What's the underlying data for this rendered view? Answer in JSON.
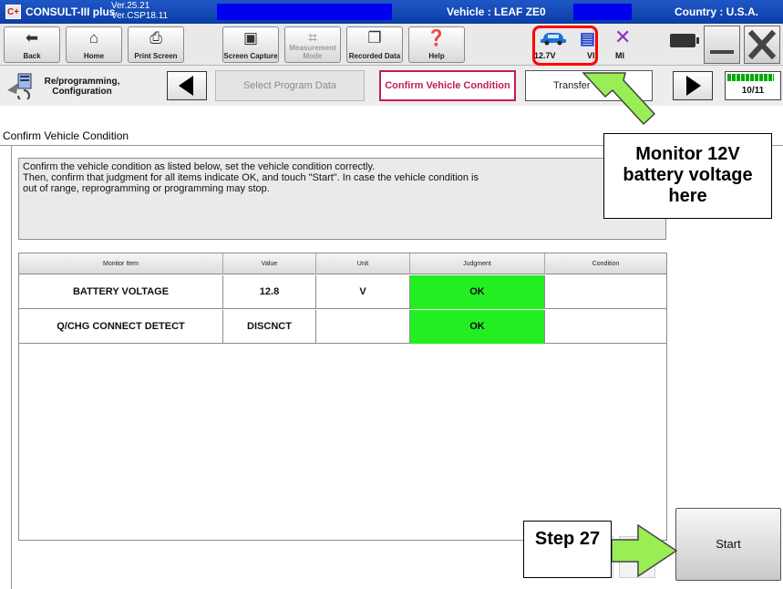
{
  "titlebar": {
    "logo": "C+",
    "app_name": "CONSULT-III plus",
    "version_line1": "Ver.25.21",
    "version_line2": "Ver.CSP18.11",
    "vehicle": "Vehicle : LEAF ZE0",
    "country": "Country : U.S.A."
  },
  "toolbar": {
    "back": "Back",
    "home": "Home",
    "print_screen": "Print Screen",
    "screen_capture": "Screen Capture",
    "measurement_mode": "Measurement Mode",
    "recorded_data": "Recorded Data",
    "help": "Help",
    "battery_voltage": "12.7V",
    "vi_label": "VI",
    "mi_label": "MI"
  },
  "stepbar": {
    "mode_label": "Re/programming, Configuration",
    "step_prev": "Select Program Data",
    "step_current": "Confirm Vehicle Condition",
    "step_next": "Transfer",
    "progress": "10/11",
    "progress_fraction": 0.91
  },
  "page": {
    "title": "Confirm Vehicle Condition",
    "instructions": "Confirm the vehicle condition as listed below, set the vehicle condition correctly.\nThen, confirm that judgment for all items indicate OK, and touch \"Start\". In case the vehicle condition is\nout of range, reprogramming or programming may stop."
  },
  "table": {
    "headers": [
      "Monitor Item",
      "Value",
      "Unit",
      "Judgment",
      "Condition"
    ],
    "rows": [
      {
        "item": "BATTERY VOLTAGE",
        "value": "12.8",
        "unit": "V",
        "judgment": "OK",
        "condition": ""
      },
      {
        "item": "Q/CHG CONNECT DETECT",
        "value": "DISCNCT",
        "unit": "",
        "judgment": "OK",
        "condition": ""
      }
    ]
  },
  "buttons": {
    "start": "Start"
  },
  "callouts": {
    "monitor": "Monitor 12V battery voltage here",
    "step": "Step 27"
  },
  "colors": {
    "title_bar": "#1446b8",
    "current_step": "#c31d4d",
    "judgment_ok": "#22ee22",
    "highlight": "#ff0000",
    "callout_arrow": "#99ee55"
  }
}
